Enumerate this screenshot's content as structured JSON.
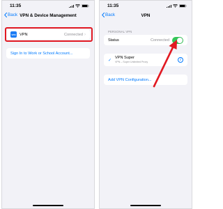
{
  "left_screen": {
    "status_bar": {
      "time": "11:35"
    },
    "nav": {
      "back_label": "Back",
      "title": "VPN & Device Management"
    },
    "vpn_row": {
      "app_icon_text": "VPN",
      "label": "VPN",
      "status": "Connected"
    },
    "sign_in_link": "Sign In to Work or School Account..."
  },
  "right_screen": {
    "status_bar": {
      "time": "11:35"
    },
    "nav": {
      "back_label": "Back",
      "title": "VPN"
    },
    "section_header": "PERSONAL VPN",
    "status_row": {
      "label": "Status",
      "value": "Connected",
      "toggle_on": true
    },
    "vpn_entry": {
      "name": "VPN Super",
      "subtitle": "VPN – Super Unlimited Proxy",
      "selected": true
    },
    "add_config_link": "Add VPN Configuration..."
  },
  "colors": {
    "accent_blue": "#007aff",
    "toggle_green": "#34c759",
    "highlight_red": "#e11922",
    "background": "#f2f2f7"
  },
  "icons": [
    "chevron-left-icon",
    "signal-icon",
    "wifi-icon",
    "battery-icon",
    "vpn-app-icon",
    "chevron-right-icon",
    "checkmark-icon",
    "info-icon",
    "arrow-annotation"
  ]
}
